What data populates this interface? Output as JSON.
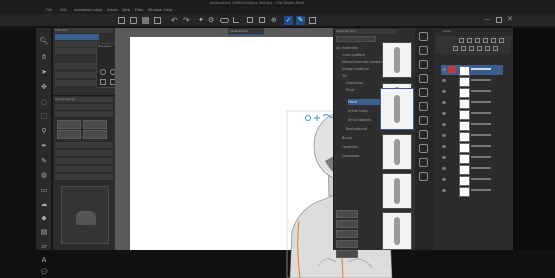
{
  "window": {
    "title": "Illustration1 (3000x2000px 300dpi) - Clip Studio Paint",
    "menu": [
      "File",
      "Edit",
      "Animation",
      "Layer",
      "Select",
      "View",
      "Filter",
      "Window",
      "Help"
    ]
  },
  "canvas_tab": {
    "label": "Illustration1"
  },
  "material_panel": {
    "title": "Material [3D]",
    "items": [
      "All materials",
      "Color pattern",
      "Monochromatic pattern",
      "Image material",
      "3D",
      "Character",
      "Pose",
      "Hand",
      "Entire body",
      "Small objects",
      "Background",
      "Brush",
      "Favorites",
      "Download"
    ]
  },
  "sub_tool": {
    "title": "Sub Tool"
  },
  "tool_property": {
    "title": "Tool property"
  },
  "navigator": {
    "title": "Navigator"
  },
  "layer_panel": {
    "title": "Layer"
  },
  "colors": {
    "background": "#111111",
    "panel": "#2e2e2e",
    "canvas": "#ffffff",
    "highlight": "#3a5f8f",
    "accent": "#e67e22",
    "manipulator_blue": "#4a90d9"
  }
}
